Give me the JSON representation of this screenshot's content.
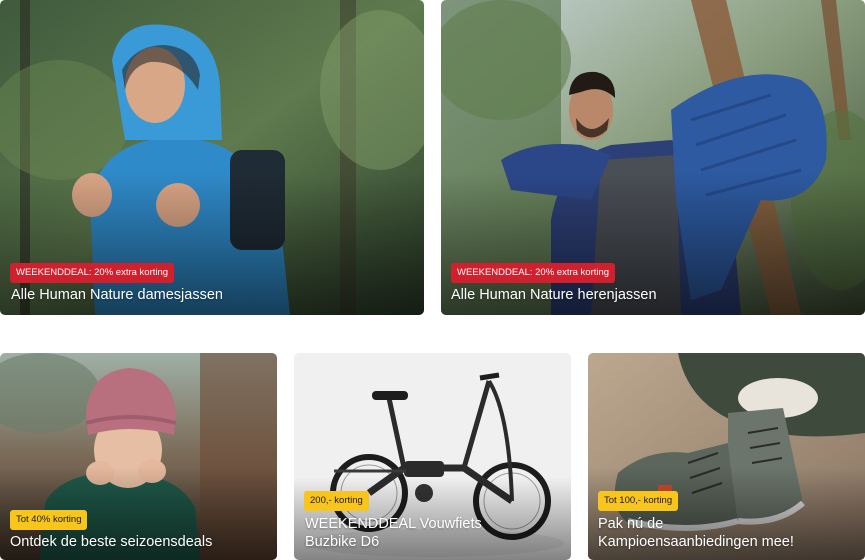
{
  "cards": [
    {
      "badge": "WEEKENDDEAL: 20% extra korting",
      "title": "Alle Human Nature damesjassen",
      "badge_color": "#d0202e"
    },
    {
      "badge": "WEEKENDDEAL: 20% extra korting",
      "title": "Alle Human Nature herenjassen",
      "badge_color": "#d0202e"
    },
    {
      "badge": "Tot 40% korting",
      "title": "Ontdek de beste seizoensdeals",
      "badge_color": "#f8c51c"
    },
    {
      "badge": "200,- korting",
      "title_line1": "WEEKENDDEAL Vouwfiets",
      "title_line2": "Buzbike D6",
      "badge_color": "#f8c51c"
    },
    {
      "badge": "Tot 100,- korting",
      "title_line1": "Pak nú de",
      "title_line2": "Kampioensaanbiedingen mee!",
      "badge_color": "#f8c51c"
    }
  ]
}
